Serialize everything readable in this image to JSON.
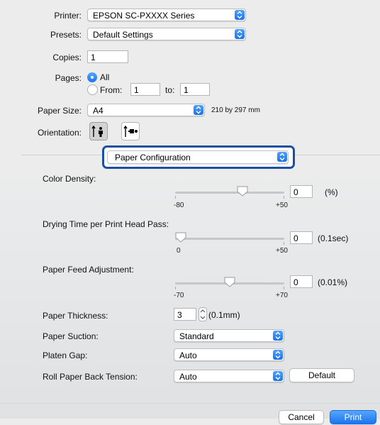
{
  "printer": {
    "label": "Printer:",
    "value": "EPSON SC-PXXXX Series"
  },
  "presets": {
    "label": "Presets:",
    "value": "Default Settings"
  },
  "copies": {
    "label": "Copies:",
    "value": "1"
  },
  "pages": {
    "label": "Pages:",
    "all_label": "All",
    "from_label": "From:",
    "from_value": "1",
    "to_label": "to:",
    "to_value": "1",
    "selected": "All"
  },
  "paper_size": {
    "label": "Paper Size:",
    "value": "A4",
    "dimensions": "210 by 297 mm"
  },
  "orientation": {
    "label": "Orientation:",
    "selected": "portrait"
  },
  "section_popup": {
    "value": "Paper Configuration"
  },
  "color_density": {
    "label": "Color Density:",
    "min": "-80",
    "max": "+50",
    "value": "0",
    "unit": "(%)"
  },
  "drying_time": {
    "label": "Drying Time per Print Head Pass:",
    "min": "0",
    "max": "+50",
    "value": "0",
    "unit": "(0.1sec)"
  },
  "paper_feed": {
    "label": "Paper Feed Adjustment:",
    "min": "-70",
    "max": "+70",
    "value": "0",
    "unit": "(0.01%)"
  },
  "paper_thickness": {
    "label": "Paper Thickness:",
    "value": "3",
    "unit": "(0.1mm)"
  },
  "paper_suction": {
    "label": "Paper Suction:",
    "value": "Standard"
  },
  "platen_gap": {
    "label": "Platen Gap:",
    "value": "Auto"
  },
  "roll_tension": {
    "label": "Roll Paper Back Tension:",
    "value": "Auto"
  },
  "buttons": {
    "default": "Default",
    "cancel": "Cancel",
    "print": "Print"
  },
  "colors": {
    "accent": "#1c74ec",
    "focus_ring": "#1a4fa3"
  }
}
